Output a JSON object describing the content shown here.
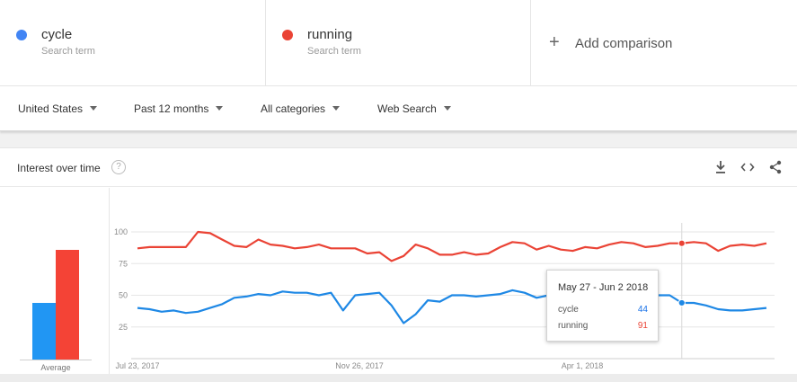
{
  "terms": [
    {
      "name": "cycle",
      "sub": "Search term",
      "color": "#4285f4"
    },
    {
      "name": "running",
      "sub": "Search term",
      "color": "#ea4335"
    }
  ],
  "add_comparison": {
    "label": "Add comparison"
  },
  "filters": {
    "region": "United States",
    "period": "Past 12 months",
    "category": "All categories",
    "search_type": "Web Search"
  },
  "interest": {
    "title": "Interest over time",
    "help": "?"
  },
  "average": {
    "label": "Average",
    "cycle": 45,
    "running": 87
  },
  "tooltip": {
    "date": "May 27 - Jun 2 2018",
    "rows": [
      {
        "name": "cycle",
        "value": "44",
        "color": "#1a73e8"
      },
      {
        "name": "running",
        "value": "91",
        "color": "#ea4335"
      }
    ]
  },
  "chart_data": {
    "type": "line",
    "x_ticks": [
      "Jul 23, 2017",
      "Nov 26, 2017",
      "Apr 1, 2018"
    ],
    "y_ticks": [
      25,
      50,
      75,
      100
    ],
    "ylim": [
      0,
      100
    ],
    "grid": true,
    "highlight_index": 45,
    "series": [
      {
        "name": "cycle",
        "color": "#1e88e5",
        "values": [
          40,
          39,
          37,
          38,
          36,
          37,
          40,
          43,
          48,
          49,
          51,
          50,
          53,
          52,
          52,
          50,
          52,
          38,
          50,
          51,
          52,
          42,
          28,
          35,
          46,
          45,
          50,
          50,
          49,
          50,
          51,
          54,
          52,
          48,
          50,
          51,
          48,
          46,
          48,
          50,
          49,
          52,
          51,
          50,
          50,
          44,
          44,
          42,
          39,
          38,
          38,
          39,
          40
        ]
      },
      {
        "name": "running",
        "color": "#ea4335",
        "values": [
          87,
          88,
          88,
          88,
          88,
          100,
          99,
          94,
          89,
          88,
          94,
          90,
          89,
          87,
          88,
          90,
          87,
          87,
          87,
          83,
          84,
          77,
          81,
          90,
          87,
          82,
          82,
          84,
          82,
          83,
          88,
          92,
          91,
          86,
          89,
          86,
          85,
          88,
          87,
          90,
          92,
          91,
          88,
          89,
          91,
          91,
          92,
          91,
          85,
          89,
          90,
          89,
          91
        ]
      }
    ]
  }
}
